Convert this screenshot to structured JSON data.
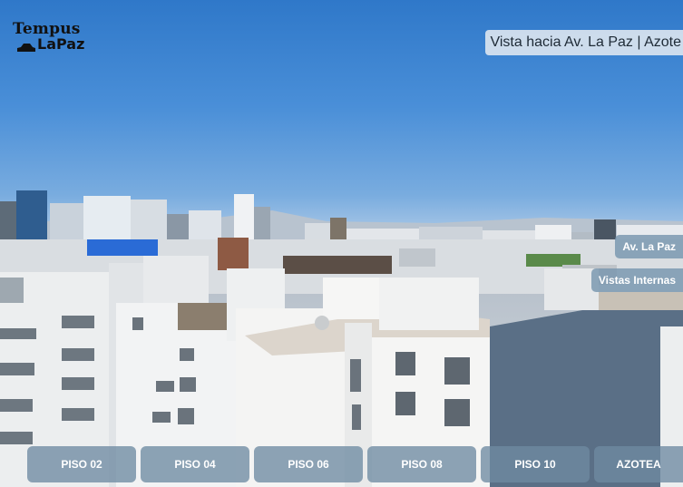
{
  "brand": {
    "line1": "Tempus",
    "line2": "LaPaz",
    "logo_icon": "car-icon"
  },
  "view_title": "Vista hacia Av. La Paz | Azote",
  "side_buttons": [
    "Av. La Paz",
    "Vistas Internas"
  ],
  "floors": [
    "PISO 02",
    "PISO 04",
    "PISO 06",
    "PISO 08",
    "PISO 10",
    "AZOTEA"
  ],
  "colors": {
    "sky": "#2f78c9",
    "button_bg": "#6e8aa2",
    "badge_bg": "#e1e8f0"
  }
}
